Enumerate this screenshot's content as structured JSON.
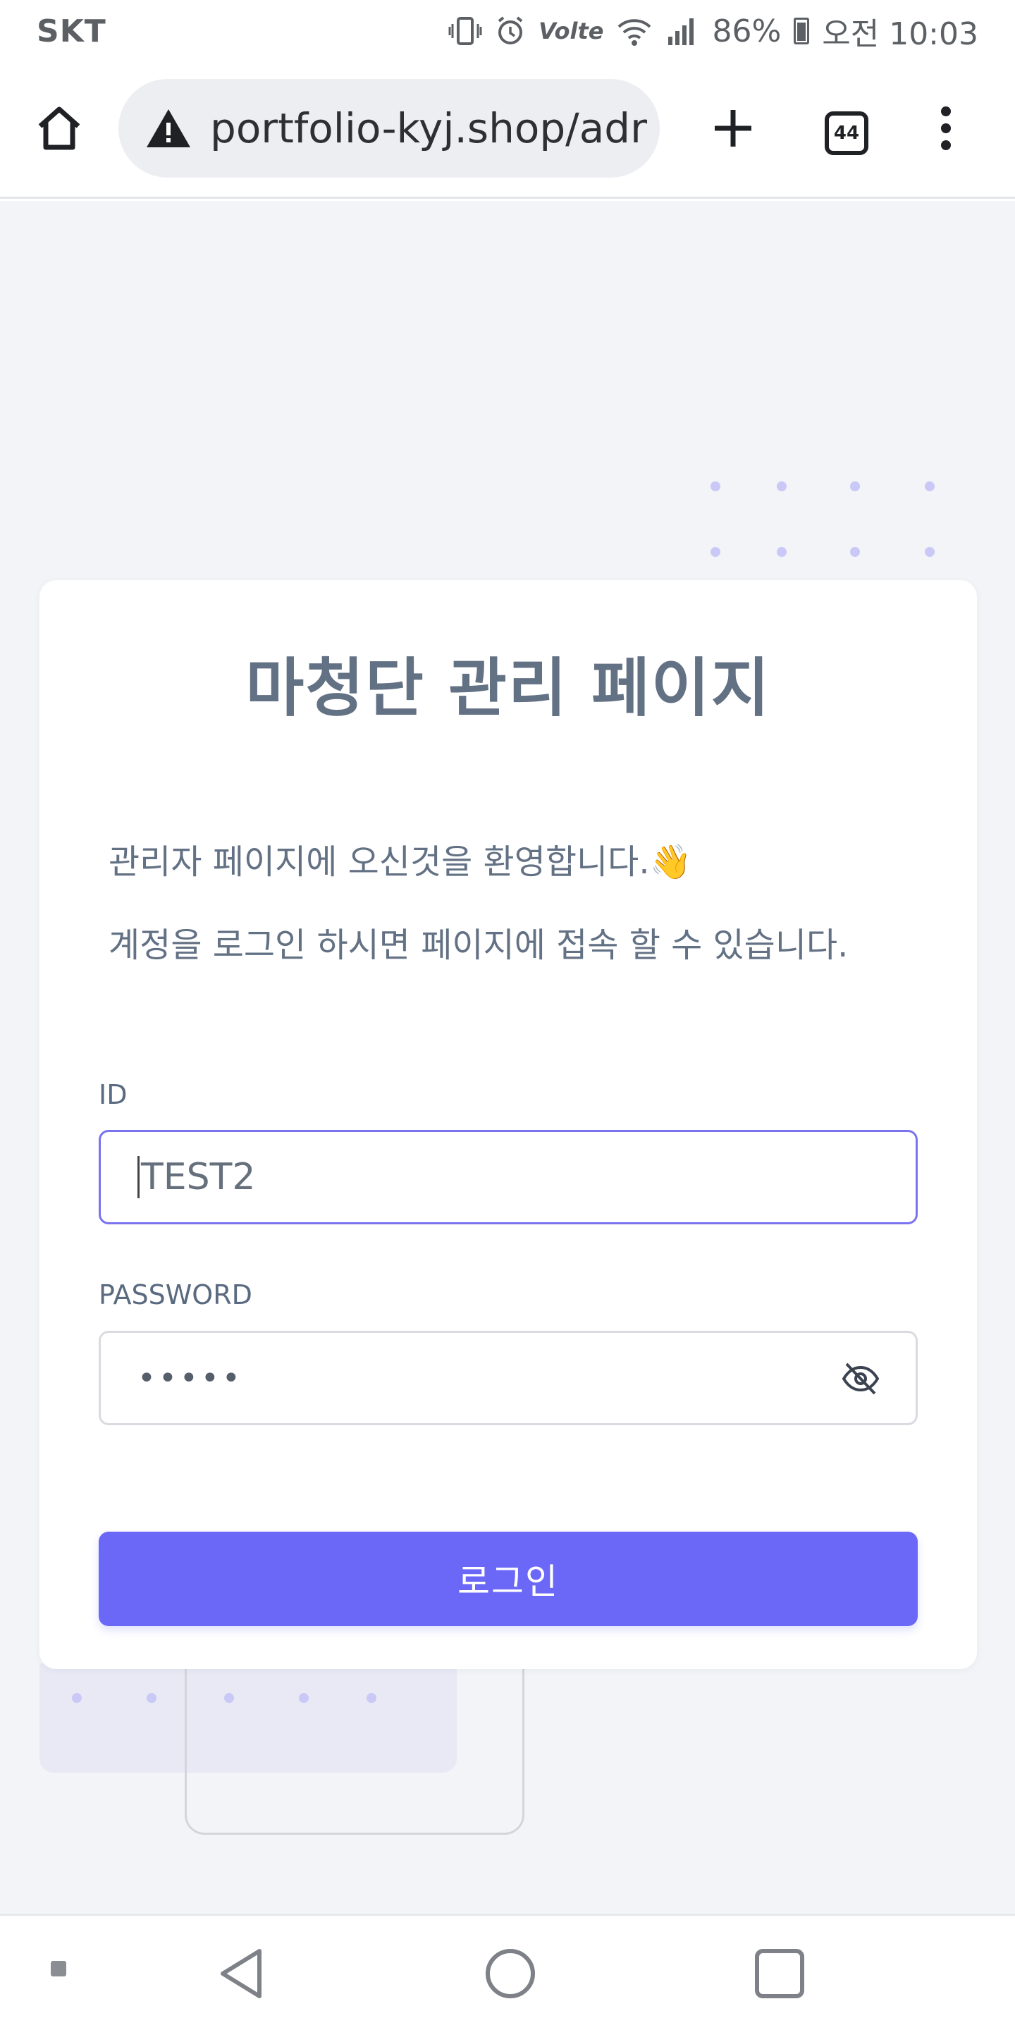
{
  "status_bar": {
    "carrier": "SKT",
    "volte": "Volte",
    "battery": "86%",
    "time": "오전 10:03"
  },
  "browser": {
    "url": "portfolio-kyj.shop/admin",
    "tab_count": "44",
    "icons": {
      "home": "home-icon",
      "warning": "warning-icon",
      "new_tab": "plus-icon",
      "menu": "more-vert-icon"
    }
  },
  "card": {
    "title": "마청단 관리 페이지",
    "welcome_line1": "관리자 페이지에 오신것을 환영합니다.👋",
    "welcome_line2": "계정을 로그인 하시면 페이지에 접속 할 수 있습니다.",
    "id_label": "ID",
    "id_value": "TEST2",
    "password_label": "PASSWORD",
    "password_value": "•••••",
    "login_label": "로그인"
  },
  "colors": {
    "accent": "#6b67f7",
    "title_text": "#637184",
    "page_bg": "#f3f4f7",
    "focus_border": "#7a73f0",
    "dots": "#c9c8f7"
  }
}
